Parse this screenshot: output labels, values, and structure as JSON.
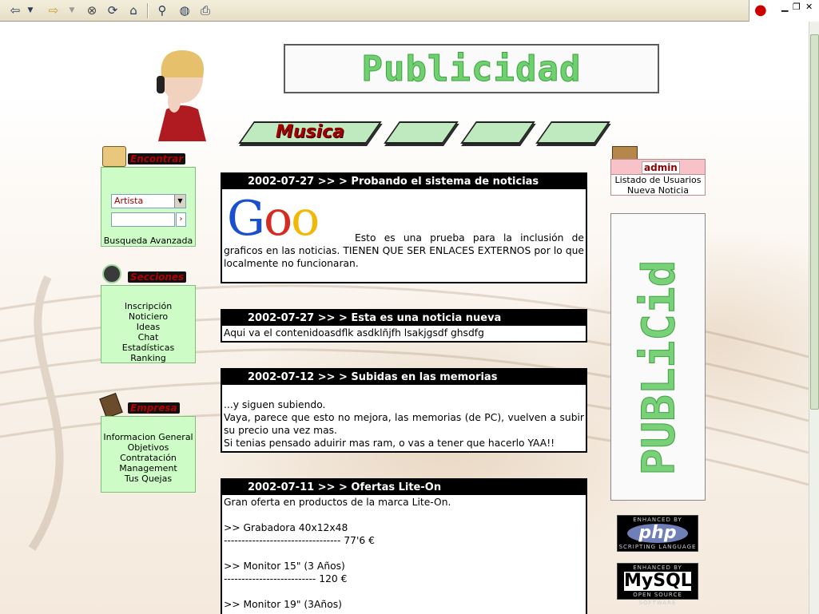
{
  "toolbar": {
    "buttons": [
      "back-arrow-icon",
      "dropdown-icon",
      "forward-arrow-icon",
      "dropdown-icon",
      "stop-icon",
      "refresh-icon",
      "home-icon",
      "search-icon",
      "globe-icon",
      "print-icon"
    ]
  },
  "header": {
    "banner_text": "Publicidad",
    "tabs": [
      {
        "label": "Musica"
      },
      {
        "label": ""
      },
      {
        "label": ""
      },
      {
        "label": ""
      }
    ]
  },
  "search_box": {
    "title": "Encontrar",
    "select_value": "Artista",
    "go_label": "›",
    "advanced_link": "Busqueda Avanzada"
  },
  "sections_box": {
    "title": "Secciones",
    "items": [
      "Inscripción",
      "Noticiero",
      "Ideas",
      "Chat",
      "Estadísticas",
      "Ranking"
    ]
  },
  "company_box": {
    "title": "Empresa",
    "items": [
      "Informacion General",
      "Objetivos",
      "Contratación",
      "Management",
      "",
      "Tus Quejas"
    ]
  },
  "admin_box": {
    "title": "admin",
    "links": [
      "Listado de Usuarios",
      "Nueva Noticia"
    ]
  },
  "vertical_banner": {
    "text": "PUBLiCid"
  },
  "badges": {
    "php": {
      "top": "ENHANCED BY",
      "main": "php",
      "bottom": "SCRIPTING LANGUAGE"
    },
    "mysql": {
      "top": "ENHANCED BY",
      "main": "MySQL",
      "bottom": "OPEN SOURCE SOFTWARE"
    }
  },
  "news": [
    {
      "date": "2002-07-27",
      "title": ">> > Probando el sistema de noticias",
      "image_text": "Goo",
      "lines": [
        "Esto es una prueba para la inclusión de graficos en las noticias. TIENEN QUE SER ENLACES EXTERNOS por lo que localmente no funcionaran."
      ]
    },
    {
      "date": "2002-07-27",
      "title": ">> > Esta es una noticia nueva",
      "lines": [
        "Aqui va el contenidoasdflk asdklñjfh lsakjgsdf ghsdfg"
      ]
    },
    {
      "date": "2002-07-12",
      "title": ">> > Subidas en las memorias",
      "lines": [
        "",
        "...y siguen subiendo.",
        "Vaya, parece que esto no mejora, las memorias (de PC), vuelven a subir su precio una vez mas.",
        "Si tenias pensado aduirir mas ram, o vas a tener que hacerlo YAA!!"
      ]
    },
    {
      "date": "2002-07-11",
      "title": ">> > Ofertas Lite-On",
      "lines": [
        "Gran oferta en productos de la marca Lite-On.",
        "",
        ">> Grabadora 40x12x48",
        "--------------------------------- 77'6 €",
        "",
        ">> Monitor 15\" (3 Años)",
        "-------------------------- 120 €",
        "",
        ">> Monitor 19\" (3Años)"
      ]
    }
  ]
}
